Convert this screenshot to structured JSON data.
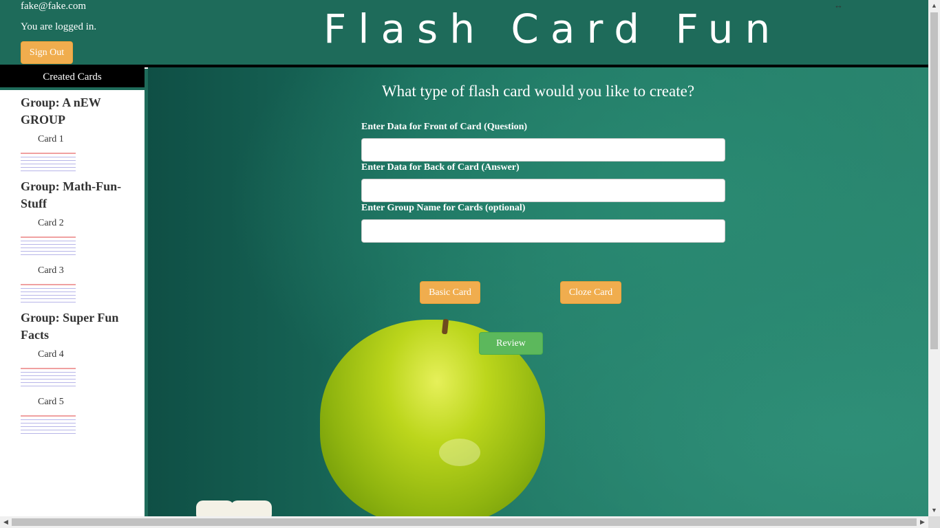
{
  "header": {
    "user_email": "fake@fake.com",
    "login_status": "You are logged in.",
    "signout_label": "Sign Out",
    "title": "Flash Card Fun",
    "resize_glyph": "↔"
  },
  "sidebar": {
    "heading": "Created Cards",
    "groups": [
      {
        "title": "Group: A nEW GROUP",
        "cards": [
          "Card 1"
        ]
      },
      {
        "title": "Group: Math-Fun-Stuff",
        "cards": [
          "Card 2",
          "Card 3"
        ]
      },
      {
        "title": "Group: Super Fun Facts",
        "cards": [
          "Card 4",
          "Card 5"
        ]
      }
    ]
  },
  "main": {
    "question": "What type of flash card would you like to create?",
    "front_label": "Enter Data for Front of Card (Question)",
    "front_value": "",
    "back_label": "Enter Data for Back of Card (Answer)",
    "back_value": "",
    "group_label": "Enter Group Name for Cards (optional)",
    "group_value": "",
    "basic_label": "Basic Card",
    "cloze_label": "Cloze Card",
    "review_label": "Review"
  },
  "colors": {
    "header_bg": "#1e6b5a",
    "accent_orange": "#f0ad4e",
    "accent_green": "#5cb85c"
  },
  "icons": [
    "resize-horizontal-icon",
    "scroll-up-icon",
    "scroll-down-icon",
    "scroll-left-icon",
    "scroll-right-icon"
  ]
}
